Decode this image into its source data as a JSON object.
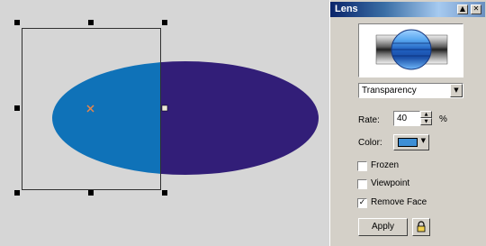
{
  "docker": {
    "title": "Lens",
    "lens_type": "Transparency",
    "rate_label": "Rate:",
    "rate_value": "40",
    "rate_unit": "%",
    "color_label": "Color:",
    "color_value": "#3d8fd6",
    "frozen_label": "Frozen",
    "frozen_checked": false,
    "viewpoint_label": "Viewpoint",
    "viewpoint_checked": false,
    "remove_face_label": "Remove Face",
    "remove_face_checked": true,
    "apply_label": "Apply"
  },
  "canvas": {
    "ellipse_left_color": "#0f72b8",
    "ellipse_right_color": "#321e78",
    "background_color": "#d6d6d6"
  },
  "icons": {
    "minimize": "minimize-icon",
    "close": "close-icon",
    "dropdown": "chevron-down-icon",
    "lock": "lock-icon",
    "center": "x-marker-icon"
  }
}
